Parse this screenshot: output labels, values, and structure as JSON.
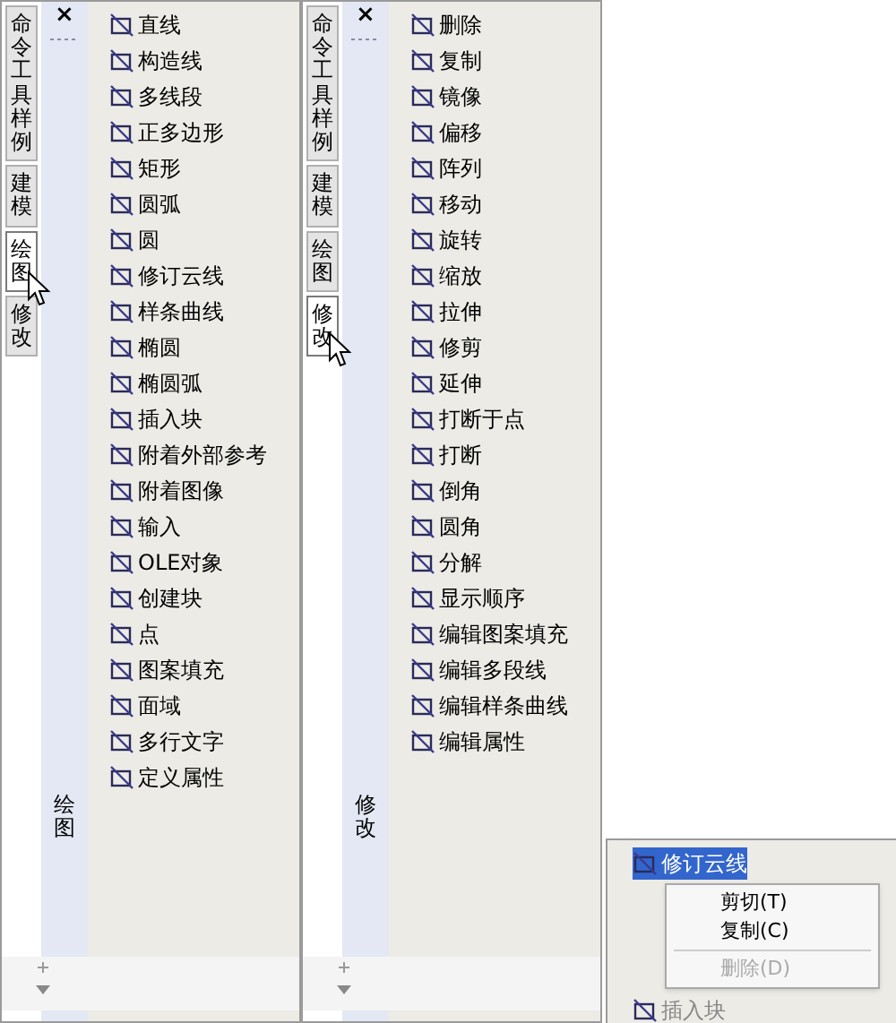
{
  "panels": [
    {
      "close": "×",
      "title": "绘图",
      "tabs": [
        {
          "label": "命令工具样例",
          "selected": false
        },
        {
          "label": "建模",
          "selected": false
        },
        {
          "label": "绘图",
          "selected": true
        },
        {
          "label": "修改",
          "selected": false
        }
      ],
      "items": [
        "直线",
        "构造线",
        "多线段",
        "正多边形",
        "矩形",
        "圆弧",
        "圆",
        "修订云线",
        "样条曲线",
        "椭圆",
        "椭圆弧",
        "插入块",
        "附着外部参考",
        "附着图像",
        "输入",
        "OLE对象",
        "创建块",
        "点",
        "图案填充",
        "面域",
        "多行文字",
        "定义属性"
      ]
    },
    {
      "close": "×",
      "title": "修改",
      "tabs": [
        {
          "label": "命令工具样例",
          "selected": false
        },
        {
          "label": "建模",
          "selected": false
        },
        {
          "label": "绘图",
          "selected": false
        },
        {
          "label": "修改",
          "selected": true
        }
      ],
      "items": [
        "删除",
        "复制",
        "镜像",
        "偏移",
        "阵列",
        "移动",
        "旋转",
        "缩放",
        "拉伸",
        "修剪",
        "延伸",
        "打断于点",
        "打断",
        "倒角",
        "圆角",
        "分解",
        "显示顺序",
        "编辑图案填充",
        "编辑多段线",
        "编辑样条曲线",
        "编辑属性"
      ]
    }
  ],
  "popup": {
    "items": [
      {
        "label": "修订云线",
        "selected": true
      },
      {
        "label": "插入块",
        "selected": false
      }
    ],
    "menu": [
      {
        "label": "剪切(T)",
        "disabled": false
      },
      {
        "label": "复制(C)",
        "disabled": false
      },
      {
        "label": "删除(D)",
        "disabled": true
      }
    ]
  }
}
